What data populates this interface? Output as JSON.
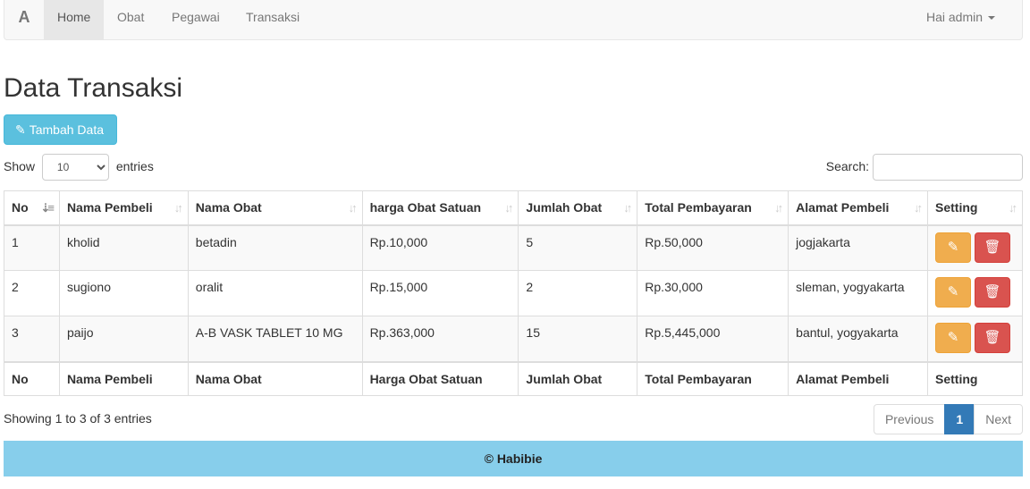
{
  "navbar": {
    "brand": "A",
    "items": [
      {
        "label": "Home"
      },
      {
        "label": "Obat"
      },
      {
        "label": "Pegawai"
      },
      {
        "label": "Transaksi"
      }
    ],
    "user": "Hai admin"
  },
  "page_title": "Data Transaksi",
  "add_button": "Tambah Data",
  "length": {
    "show": "Show",
    "value": "10",
    "entries": "entries"
  },
  "search": {
    "label": "Search:",
    "value": ""
  },
  "table": {
    "headers": [
      "No",
      "Nama Pembeli",
      "Nama Obat",
      "harga Obat Satuan",
      "Jumlah Obat",
      "Total Pembayaran",
      "Alamat Pembeli",
      "Setting"
    ],
    "footers": [
      "No",
      "Nama Pembeli",
      "Nama Obat",
      "Harga Obat Satuan",
      "Jumlah Obat",
      "Total Pembayaran",
      "Alamat Pembeli",
      "Setting"
    ],
    "rows": [
      [
        "1",
        "kholid",
        "betadin",
        "Rp.10,000",
        "5",
        "Rp.50,000",
        "jogjakarta"
      ],
      [
        "2",
        "sugiono",
        "oralit",
        "Rp.15,000",
        "2",
        "Rp.30,000",
        "sleman, yogyakarta"
      ],
      [
        "3",
        "paijo",
        "A-B VASK TABLET 10 MG",
        "Rp.363,000",
        "15",
        "Rp.5,445,000",
        "bantul, yogyakarta"
      ]
    ]
  },
  "info": "Showing 1 to 3 of 3 entries",
  "pagination": {
    "previous": "Previous",
    "current": "1",
    "next": "Next"
  },
  "footer": "© Habibie"
}
